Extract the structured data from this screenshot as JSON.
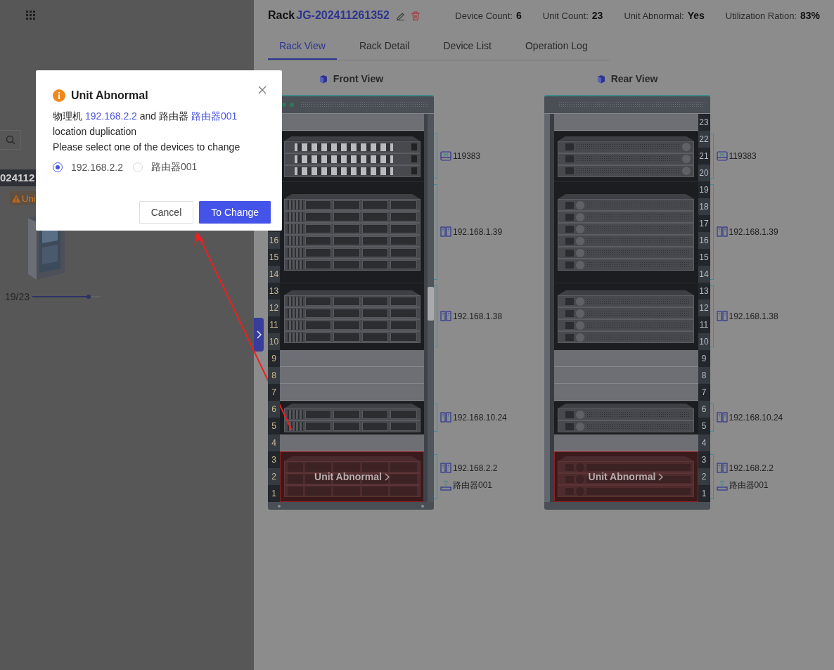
{
  "background_page": {
    "rack_code": "024112",
    "tag": {
      "label": "Uni"
    },
    "usage": {
      "reading": "19/23",
      "level": 0.82
    }
  },
  "drawer": {
    "title": {
      "prefix": "Rack",
      "code": "JG-202411261352"
    },
    "stats": [
      {
        "label": "Device Count:",
        "value": "6"
      },
      {
        "label": "Unit Count:",
        "value": "23"
      },
      {
        "label": "Unit Abnormal:",
        "value": "Yes"
      },
      {
        "label": "Utilization Ration:",
        "value": "83%"
      }
    ],
    "tabs": [
      {
        "label": "Rack View",
        "selected": true
      },
      {
        "label": "Rack Detail",
        "selected": false
      },
      {
        "label": "Device List",
        "selected": false
      },
      {
        "label": "Operation Log",
        "selected": false
      }
    ],
    "views": [
      {
        "title": "Front View",
        "kind": "front",
        "slots": [
          {
            "kind": "empty"
          },
          {
            "kind": "switch",
            "labels": [
              {
                "name": "119383",
                "kind": "switch"
              }
            ]
          },
          {
            "kind": "server",
            "units": [
              "16",
              "15",
              "14"
            ],
            "labels": [
              {
                "name": "192.168.1.39",
                "kind": "server"
              }
            ]
          },
          {
            "kind": "server",
            "units": [
              "13",
              "12",
              "11",
              "10"
            ],
            "labels": [
              {
                "name": "192.168.1.38",
                "kind": "server"
              }
            ]
          },
          {
            "kind": "empty",
            "units": [
              "9"
            ]
          },
          {
            "kind": "empty",
            "units": [
              "8"
            ]
          },
          {
            "kind": "empty",
            "units": [
              "7"
            ]
          },
          {
            "kind": "server",
            "units": [
              "6",
              "5"
            ],
            "labels": [
              {
                "name": "192.168.10.24",
                "kind": "server"
              }
            ]
          },
          {
            "kind": "empty",
            "units": [
              "4"
            ]
          },
          {
            "kind": "server",
            "abnormal": true,
            "message": "Unit Abnormal",
            "units": [
              "3",
              "2",
              "1"
            ],
            "labels": [
              {
                "name": "192.168.2.2",
                "kind": "server"
              },
              {
                "name": "路由器001",
                "kind": "router"
              }
            ]
          }
        ]
      },
      {
        "title": "Rear View",
        "kind": "rear",
        "slots": [
          {
            "kind": "empty",
            "units": [
              "23"
            ]
          },
          {
            "kind": "switch",
            "units": [
              "22",
              "21",
              "20"
            ],
            "labels": [
              {
                "name": "119383",
                "kind": "switch"
              }
            ]
          },
          {
            "kind": "server",
            "units": [
              "19",
              "18",
              "17",
              "16",
              "15",
              "14"
            ],
            "labels": [
              {
                "name": "192.168.1.39",
                "kind": "server"
              }
            ]
          },
          {
            "kind": "server",
            "units": [
              "13",
              "12",
              "11",
              "10"
            ],
            "labels": [
              {
                "name": "192.168.1.38",
                "kind": "server"
              }
            ]
          },
          {
            "kind": "empty",
            "units": [
              "9"
            ]
          },
          {
            "kind": "empty",
            "units": [
              "8"
            ]
          },
          {
            "kind": "empty",
            "units": [
              "7"
            ]
          },
          {
            "kind": "server",
            "units": [
              "6",
              "5"
            ],
            "labels": [
              {
                "name": "192.168.10.24",
                "kind": "server"
              }
            ]
          },
          {
            "kind": "empty",
            "units": [
              "4"
            ]
          },
          {
            "kind": "server",
            "abnormal": true,
            "message": "Unit Abnormal",
            "units": [
              "3",
              "2",
              "1"
            ],
            "labels": [
              {
                "name": "192.168.2.2",
                "kind": "server"
              },
              {
                "name": "路由器001",
                "kind": "router"
              }
            ]
          }
        ]
      }
    ]
  },
  "dialog": {
    "title": "Unit Abnormal",
    "message": [
      {
        "kind": "text",
        "text": "物理机 "
      },
      {
        "kind": "link",
        "text": "192.168.2.2"
      },
      {
        "kind": "text",
        "text": " and 路由器 "
      },
      {
        "kind": "link",
        "text": "路由器001"
      },
      {
        "kind": "text",
        "text": " location duplication"
      }
    ],
    "prompt": "Please select one of the devices to change",
    "options": [
      {
        "label": "192.168.2.2",
        "selected": true
      },
      {
        "label": "路由器001",
        "selected": false
      }
    ],
    "buttons": [
      {
        "label": "Cancel",
        "kind": "secondary"
      },
      {
        "label": "To Change",
        "kind": "primary"
      }
    ]
  }
}
